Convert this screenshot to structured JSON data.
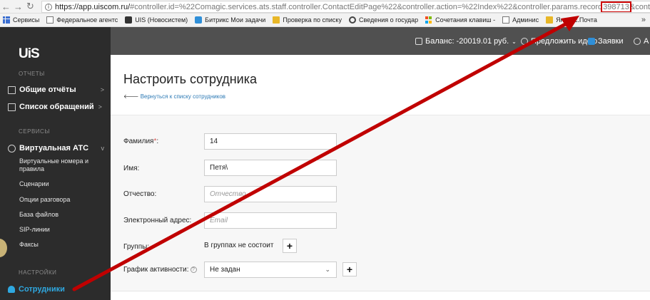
{
  "browser": {
    "url_host": "https://app.uiscom.ru/",
    "url_path": "#controller.id=%22Comagic.services.ats.staff.controller.ContactEditPage%22&controller.action=%22Index%22&controller.params.record",
    "url_highlight": "398713",
    "url_tail": "&controlle",
    "highlight_color": "#cc0000"
  },
  "bookmarks": {
    "items": [
      {
        "label": "Сервисы",
        "icon": "apps-icon"
      },
      {
        "label": "Федеральное агентс",
        "icon": "page-icon"
      },
      {
        "label": "UIS (Новосистем)",
        "icon": "uis-icon"
      },
      {
        "label": "Битрикс Мои задачи",
        "icon": "bitrix-icon"
      },
      {
        "label": "Проверка по списку",
        "icon": "check-icon"
      },
      {
        "label": "Сведения о государ",
        "icon": "gov-icon"
      },
      {
        "label": "Сочетания клавиш -",
        "icon": "windows-icon"
      },
      {
        "label": "Админис",
        "icon": "page-icon"
      },
      {
        "label": "Яндекс.Почта",
        "icon": "mail-icon"
      }
    ],
    "more": "»"
  },
  "sidebar": {
    "logo": "UiS",
    "section_reports": "ОТЧЕТЫ",
    "general_reports": "Общие отчёты",
    "calls_list": "Список обращений",
    "section_services": "СЕРВИСЫ",
    "virtual_ats": "Виртуальная АТС",
    "sub_items": [
      "Виртуальные номера и правила",
      "Сценарии",
      "Опции разговора",
      "База файлов",
      "SIP-линии",
      "Факсы"
    ],
    "section_settings": "НАСТРОЙКИ",
    "employees": "Сотрудники",
    "chevron": ">",
    "chevron_down": "v",
    "accent_color": "#2fa8e0"
  },
  "header": {
    "balance": "Баланс: -20019.01 руб.",
    "suggest": "Предложить идею",
    "requests": "Заявки",
    "account": "А"
  },
  "page": {
    "title": "Настроить сотрудника",
    "back_link": "Вернуться к списку сотрудников",
    "form": {
      "last_name_label": "Фамилия",
      "required_mark": "*",
      "last_name_colon": ":",
      "last_name_value": "14",
      "first_name_label": "Имя:",
      "first_name_value": "Петя\\",
      "middle_name_label": "Отчество:",
      "middle_name_placeholder": "Отчество",
      "email_label": "Электронный адрес:",
      "email_placeholder": "Email",
      "groups_label": "Группы:",
      "groups_value": "В группах не состоит",
      "schedule_label": "График активности:",
      "schedule_value": "Не задан",
      "plus": "+"
    }
  }
}
